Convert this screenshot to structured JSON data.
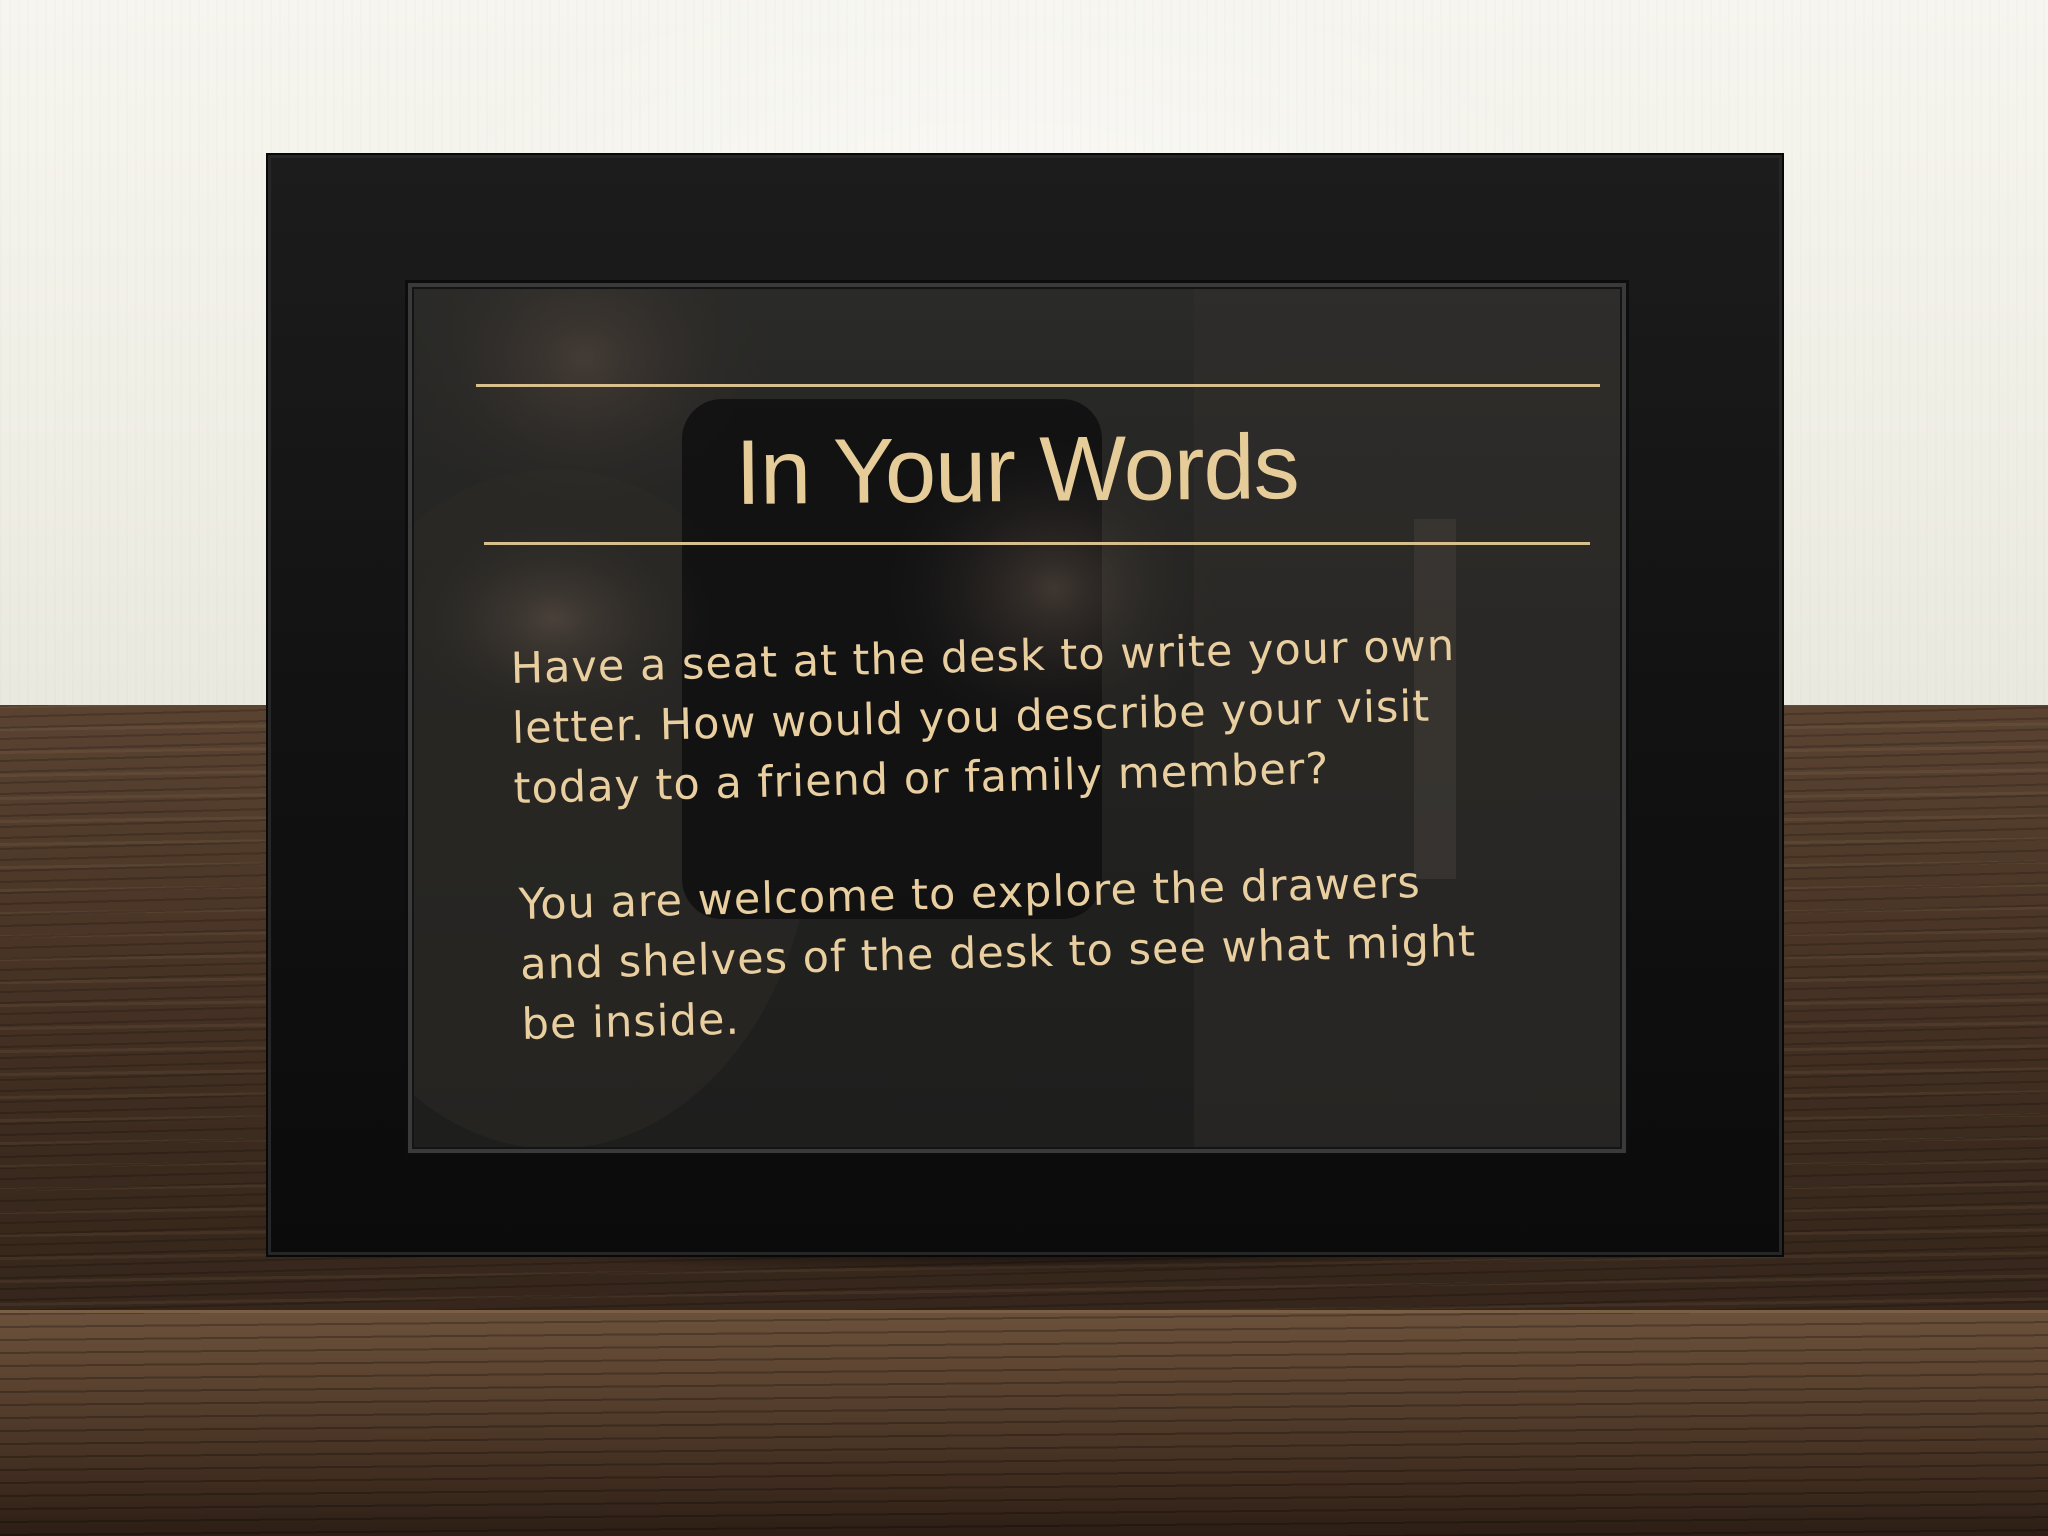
{
  "sign": {
    "title": "In Your Words",
    "paragraphs": [
      "Have a seat at the desk to write your own\nletter. How would you describe your visit\ntoday to a friend or family member?",
      "You are welcome to explore the drawers\nand shelves of the desk to see what might\nbe inside."
    ],
    "text_color": "#e6cc98",
    "frame_color": "#111111"
  }
}
